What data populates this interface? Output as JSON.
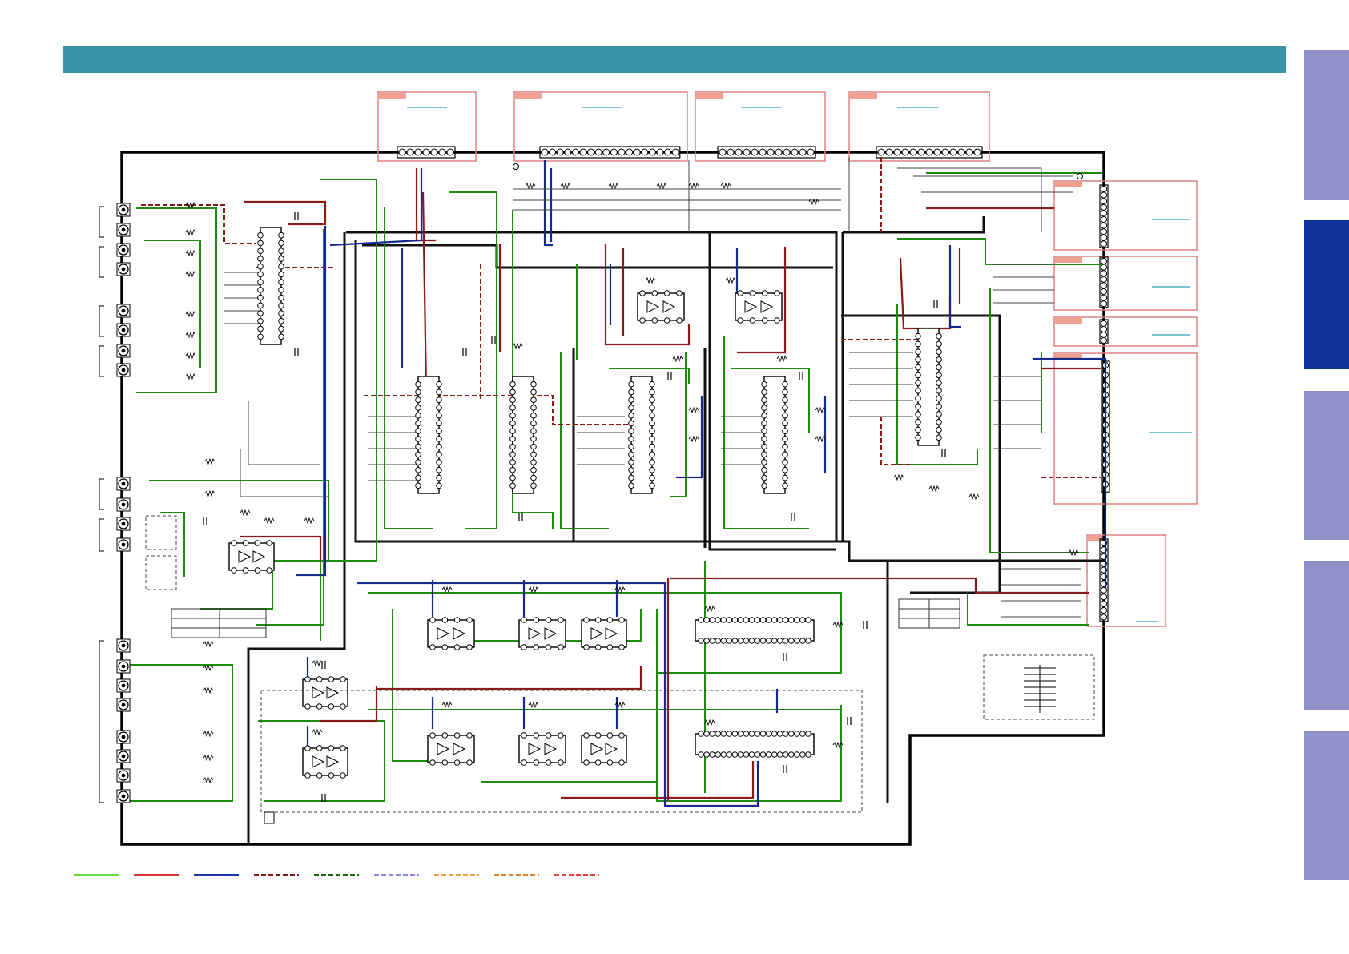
{
  "colors": {
    "header": "#3a93a7",
    "tab_inactive": "#9090c8",
    "tab_active": "#10349a",
    "board_outline": "#000000",
    "wire_green": "#1f8a10",
    "wire_red": "#8b1a1a",
    "wire_blue": "#1a2a8a",
    "wire_dark": "#333333",
    "connector_box": "#e08080",
    "connector_tag": "#f0a090",
    "connector_link": "#2aa0c0"
  },
  "tabs": [
    {
      "id": "tab-1",
      "active": false
    },
    {
      "id": "tab-2",
      "active": true
    },
    {
      "id": "tab-3",
      "active": false
    },
    {
      "id": "tab-4",
      "active": false
    },
    {
      "id": "tab-5",
      "active": false
    }
  ],
  "legend": [
    {
      "color": "#66dd44",
      "style": "solid"
    },
    {
      "color": "#dd3333",
      "style": "solid"
    },
    {
      "color": "#2233aa",
      "style": "solid"
    },
    {
      "color": "#8b1a1a",
      "style": "dashed"
    },
    {
      "color": "#1f6a10",
      "style": "dashed"
    },
    {
      "color": "#8888ee",
      "style": "dashed"
    },
    {
      "color": "#e8a040",
      "style": "dashed"
    },
    {
      "color": "#e08030",
      "style": "dashed"
    },
    {
      "color": "#e04040",
      "style": "dashed"
    }
  ],
  "icons": [
    "chip-icon",
    "connector-icon",
    "jack-icon",
    "resistor-icon"
  ]
}
